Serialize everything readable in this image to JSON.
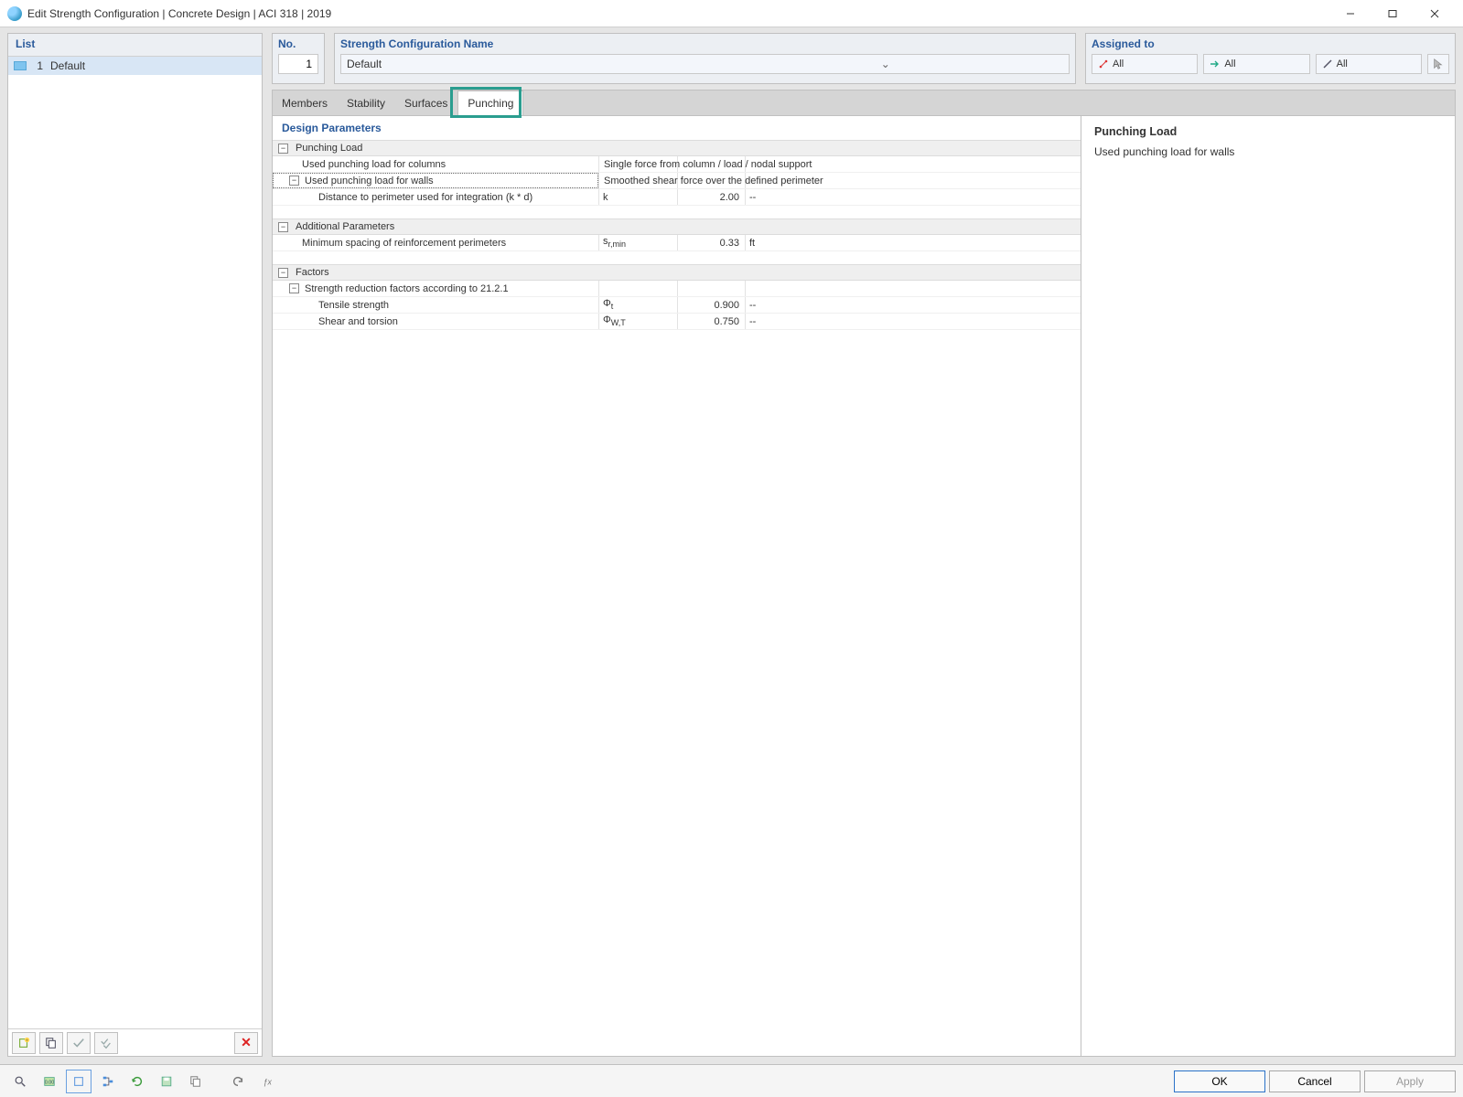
{
  "window": {
    "title": "Edit Strength Configuration | Concrete Design | ACI 318 | 2019"
  },
  "leftPanel": {
    "header": "List",
    "items": [
      {
        "num": "1",
        "name": "Default"
      }
    ]
  },
  "fields": {
    "noLabel": "No.",
    "noValue": "1",
    "nameLabel": "Strength Configuration Name",
    "nameValue": "Default",
    "assignedLabel": "Assigned to",
    "assignedPills": [
      "All",
      "All",
      "All"
    ]
  },
  "tabs": [
    "Members",
    "Stability",
    "Surfaces",
    "Punching"
  ],
  "activeTab": "Punching",
  "paramsHeader": "Design Parameters",
  "sections": {
    "punchingLoad": {
      "title": "Punching Load",
      "rows": {
        "columns": {
          "label": "Used punching load for columns",
          "desc": "Single force from column / load / nodal support"
        },
        "walls": {
          "label": "Used punching load for walls",
          "desc": "Smoothed shear force over the defined perimeter"
        },
        "distance": {
          "label": "Distance to perimeter used for integration (k * d)",
          "sym": "k",
          "val": "2.00",
          "unit": "--"
        }
      }
    },
    "additional": {
      "title": "Additional Parameters",
      "rows": {
        "spacing": {
          "label": "Minimum spacing of reinforcement perimeters",
          "sym": "sr,min",
          "val": "0.33",
          "unit": "ft"
        }
      }
    },
    "factors": {
      "title": "Factors",
      "rows": {
        "srf": {
          "label": "Strength reduction factors according to 21.2.1"
        },
        "tensile": {
          "label": "Tensile strength",
          "sym": "Φt",
          "val": "0.900",
          "unit": "--"
        },
        "shear": {
          "label": "Shear and torsion",
          "sym": "ΦW,T",
          "val": "0.750",
          "unit": "--"
        }
      }
    }
  },
  "infoPanel": {
    "heading": "Punching Load",
    "text": "Used punching load for walls"
  },
  "buttons": {
    "ok": "OK",
    "cancel": "Cancel",
    "apply": "Apply"
  }
}
